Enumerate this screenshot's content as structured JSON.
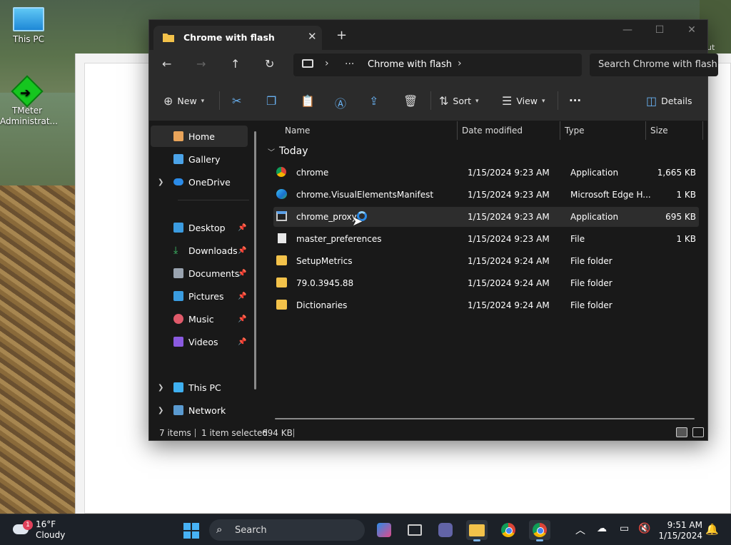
{
  "desktop": {
    "icons": [
      {
        "label": "This PC"
      },
      {
        "label": "TMeter\nAdministrat..."
      }
    ],
    "partial_text": "ut"
  },
  "window": {
    "tab_title": "Chrome with flash",
    "address": {
      "crumb": "Chrome with flash",
      "ellipsis": "···"
    },
    "search_placeholder": "Search Chrome with flash",
    "toolbar": {
      "new_label": "New",
      "sort_label": "Sort",
      "view_label": "View",
      "more_label": "···",
      "details_label": "Details"
    },
    "nav": {
      "items": [
        {
          "label": "Home"
        },
        {
          "label": "Gallery"
        },
        {
          "label": "OneDrive"
        },
        {
          "label": "Desktop"
        },
        {
          "label": "Downloads"
        },
        {
          "label": "Documents"
        },
        {
          "label": "Pictures"
        },
        {
          "label": "Music"
        },
        {
          "label": "Videos"
        },
        {
          "label": "This PC"
        },
        {
          "label": "Network"
        }
      ]
    },
    "columns": {
      "name": "Name",
      "date": "Date modified",
      "type": "Type",
      "size": "Size"
    },
    "group_label": "Today",
    "files": [
      {
        "name": "chrome",
        "date": "1/15/2024 9:23 AM",
        "type": "Application",
        "size": "1,665 KB",
        "icon": "chrome-icon"
      },
      {
        "name": "chrome.VisualElementsManifest",
        "date": "1/15/2024 9:23 AM",
        "type": "Microsoft Edge H...",
        "size": "1 KB",
        "icon": "edge-icon"
      },
      {
        "name": "chrome_proxy",
        "date": "1/15/2024 9:23 AM",
        "type": "Application",
        "size": "695 KB",
        "icon": "application-icon"
      },
      {
        "name": "master_preferences",
        "date": "1/15/2024 9:23 AM",
        "type": "File",
        "size": "1 KB",
        "icon": "file-icon"
      },
      {
        "name": "SetupMetrics",
        "date": "1/15/2024 9:24 AM",
        "type": "File folder",
        "size": "",
        "icon": "folder-icon"
      },
      {
        "name": "79.0.3945.88",
        "date": "1/15/2024 9:24 AM",
        "type": "File folder",
        "size": "",
        "icon": "folder-icon"
      },
      {
        "name": "Dictionaries",
        "date": "1/15/2024 9:24 AM",
        "type": "File folder",
        "size": "",
        "icon": "folder-icon"
      }
    ],
    "status": {
      "items_count": "7 items",
      "selected": "1 item selected",
      "selected_size": "694 KB"
    }
  },
  "taskbar": {
    "weather_temp": "16°F",
    "weather_desc": "Cloudy",
    "weather_badge": "1",
    "search_label": "Search",
    "time": "9:51 AM",
    "date": "1/15/2024"
  },
  "colors": {
    "accent": "#68b0f0",
    "window_bg": "#191919",
    "folder": "#f3c24a"
  }
}
